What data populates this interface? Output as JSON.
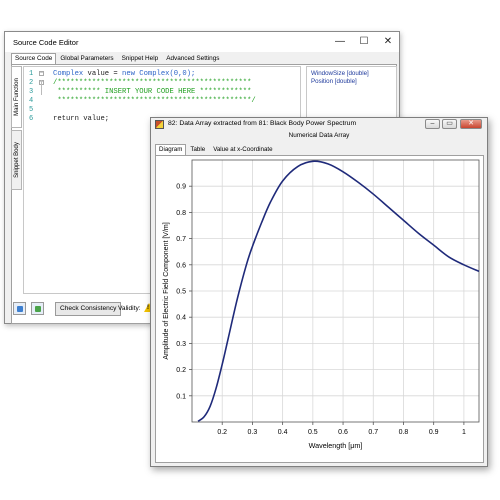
{
  "editor": {
    "title": "Source Code Editor",
    "controls": {
      "minimize": "—",
      "maximize": "☐",
      "close": "✕"
    },
    "tabs": [
      "Source Code",
      "Global Parameters",
      "Snippet Help",
      "Advanced Settings"
    ],
    "side_tabs": [
      "Main Function",
      "Snippet Body"
    ],
    "line_numbers": [
      "1",
      "2",
      "3",
      "4",
      "5",
      "6"
    ],
    "code": {
      "l1_kw": "Complex",
      "l1_mid": " value = ",
      "l1_new": "new",
      "l1_end": " Complex(0,0);",
      "l2": "/*********************************************",
      "l3": " ********** INSERT YOUR CODE HERE ************",
      "l4": " *********************************************/",
      "l6": "return value;"
    },
    "params": [
      "WindowSize [double]",
      "Position [double]"
    ],
    "check_button": "Check Consistency",
    "validity_label": "Validity:",
    "warning_mark": "!"
  },
  "data_window": {
    "title": "82: Data Array extracted from 81: Black Body Power Spectrum",
    "subtitle": "Numerical Data Array",
    "controls": {
      "minimize": "–",
      "restore": "▭",
      "close": "✕"
    },
    "tabs": [
      "Diagram",
      "Table",
      "Value at x-Coordinate"
    ]
  },
  "chart_data": {
    "type": "line",
    "xlabel": "Wavelength [μm]",
    "ylabel": "Amplitude of Electric Field Component [V/m]",
    "xlim": [
      0.1,
      1.05
    ],
    "ylim": [
      0,
      1.0
    ],
    "xticks": [
      "0.2",
      "0.3",
      "0.4",
      "0.5",
      "0.6",
      "0.7",
      "0.8",
      "0.9",
      "1"
    ],
    "yticks": [
      "0.1",
      "0.2",
      "0.3",
      "0.4",
      "0.5",
      "0.6",
      "0.7",
      "0.8",
      "0.9"
    ],
    "grid": true,
    "series": [
      {
        "color": "#1f2a7a",
        "x": [
          0.12,
          0.14,
          0.16,
          0.18,
          0.2,
          0.22,
          0.25,
          0.28,
          0.3,
          0.33,
          0.36,
          0.4,
          0.45,
          0.5,
          0.55,
          0.6,
          0.65,
          0.7,
          0.75,
          0.8,
          0.85,
          0.9,
          0.95,
          1.0,
          1.05
        ],
        "y": [
          0.003,
          0.02,
          0.06,
          0.13,
          0.22,
          0.32,
          0.47,
          0.6,
          0.67,
          0.76,
          0.84,
          0.92,
          0.975,
          0.995,
          0.985,
          0.955,
          0.915,
          0.87,
          0.82,
          0.77,
          0.72,
          0.675,
          0.63,
          0.6,
          0.575
        ]
      }
    ]
  }
}
